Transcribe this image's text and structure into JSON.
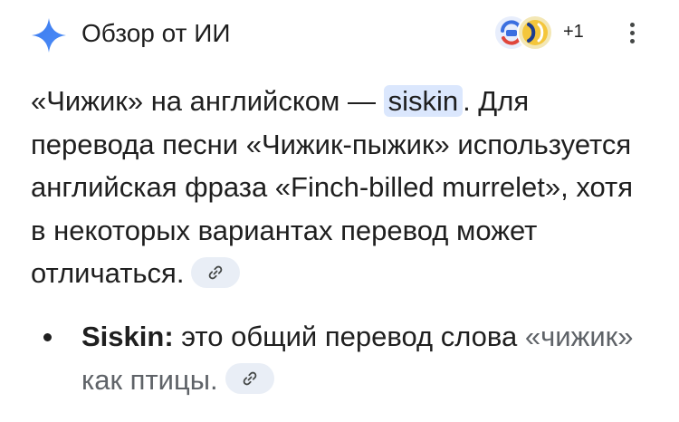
{
  "header": {
    "title": "Обзор от ИИ",
    "sources_extra": "+1",
    "icons": [
      "sparkle-icon",
      "source-favicon",
      "source-favicon",
      "more-vert-icon"
    ]
  },
  "answer": {
    "p_start": "«Чижик» на английском — ",
    "p_highlight": "siskin",
    "p_rest": ". Для перевода песни «Чижик-пыжик» используется английская фраза «Finch-billed murrelet», хотя в некоторых вариантах перевод может отличаться.",
    "link_icon": "link-icon"
  },
  "bullets": [
    {
      "term": "Siskin:",
      "text": " это общий перевод слова ",
      "text_muted": "«чижик» как птицы."
    }
  ],
  "colors": {
    "accent": "#4285f4",
    "highlight": "#dbe7fd",
    "chip": "#e9eef6",
    "text": "#1f1f1f",
    "muted": "#5f6368"
  }
}
